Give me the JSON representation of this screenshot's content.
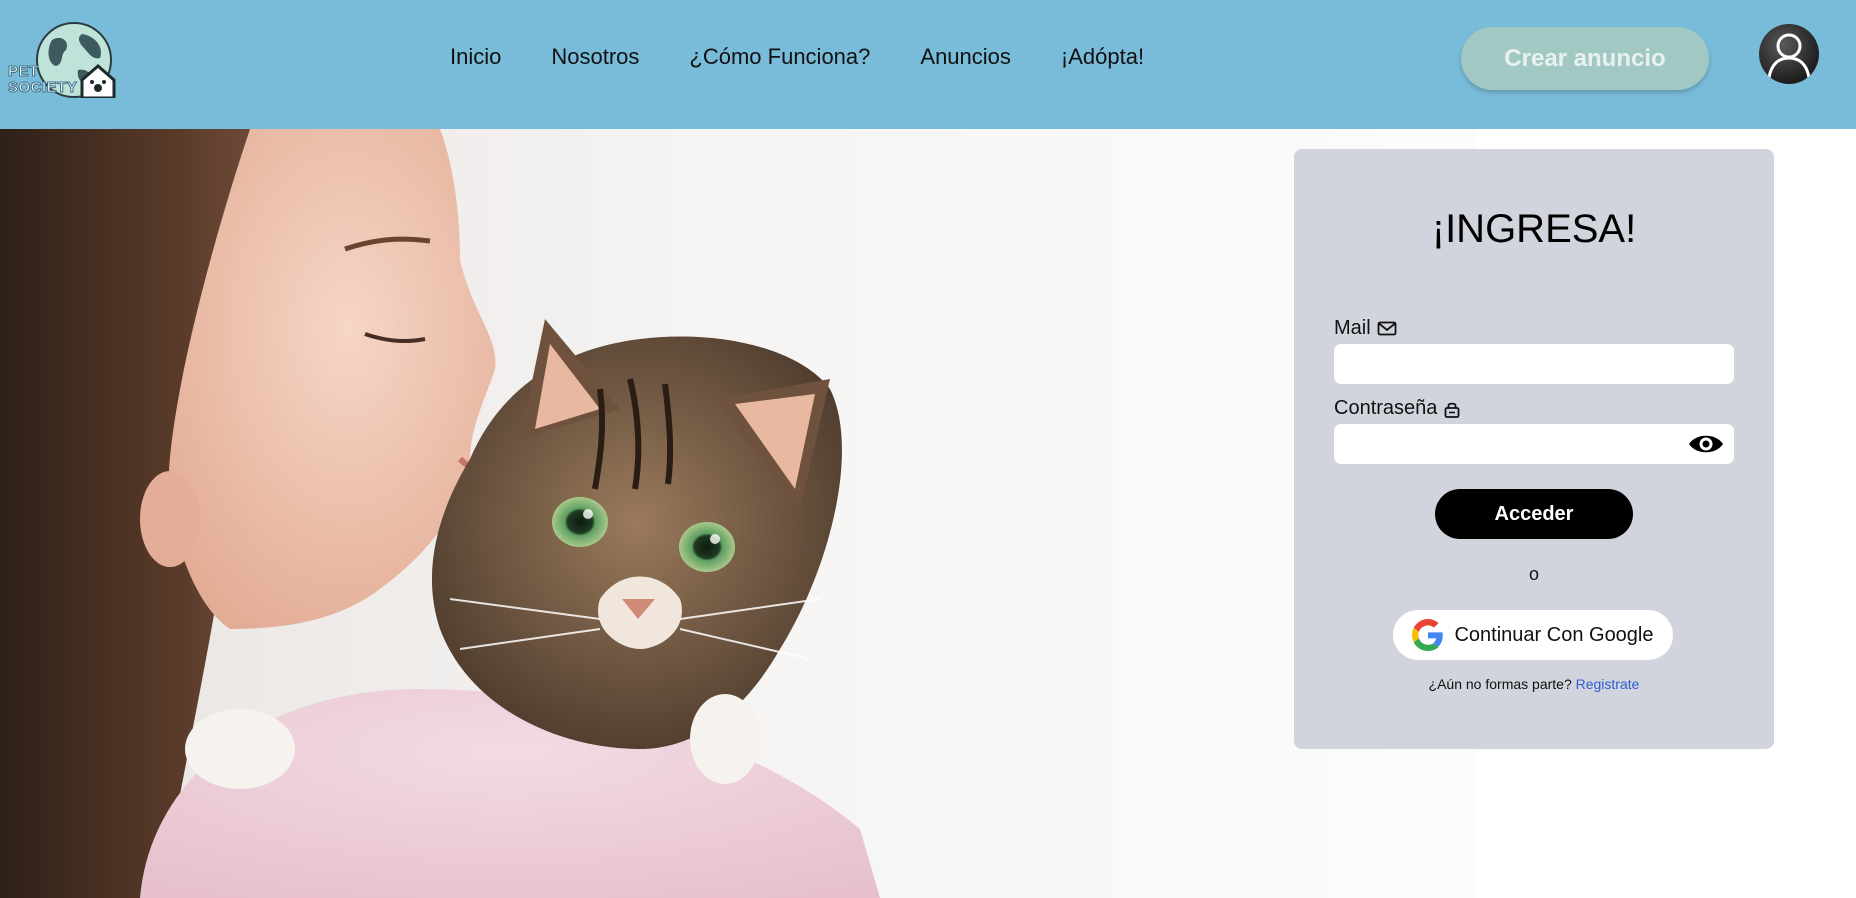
{
  "navbar": {
    "logo_line1": "PET",
    "logo_line2": "SOCIETY",
    "links": [
      "Inicio",
      "Nosotros",
      "¿Cómo Funciona?",
      "Anuncios",
      "¡Adópta!"
    ],
    "create_ad_label": "Crear anuncio",
    "avatar_icon": "user-avatar-icon"
  },
  "hero": {
    "image_icon": "woman-with-cat-photo"
  },
  "login": {
    "title": "¡INGRESA!",
    "mail_label": "Mail",
    "mail_icon": "mail-icon",
    "mail_value": "",
    "password_label": "Contraseña",
    "password_icon": "lock-icon",
    "password_value": "",
    "toggle_icon": "eye-icon",
    "submit_label": "Acceder",
    "or_text": "o",
    "google_label": "Continuar Con Google",
    "google_icon": "google-icon",
    "register_prompt": "¿Aún no formas parte?",
    "register_link": "Registrate"
  },
  "colors": {
    "navbar_bg": "#79bcd9",
    "create_ad_bg": "#a2c8c3",
    "card_bg": "#d1d4dc",
    "link": "#2f5fd0"
  }
}
